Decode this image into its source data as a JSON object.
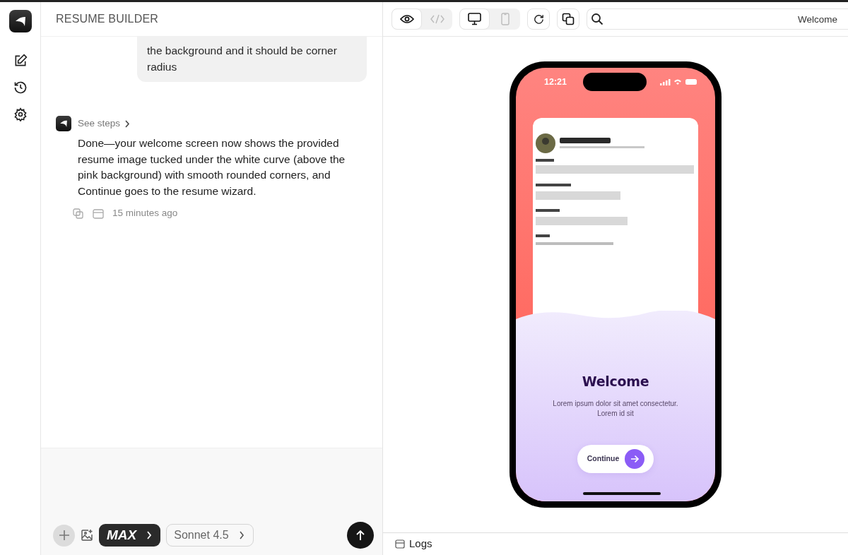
{
  "app": {
    "title": "RESUME BUILDER"
  },
  "chat": {
    "user_message": "the background and it should be corner radius",
    "steps_label": "See steps",
    "reply": "Done—your welcome screen now shows the provided resume image tucked under the white curve (above the pink background) with smooth rounded corners, and Continue goes to the resume wizard.",
    "time": "15 minutes ago"
  },
  "composer": {
    "mode": "MAX",
    "model": "Sonnet 4.5"
  },
  "preview": {
    "view_modes": [
      {
        "kind": "preview",
        "selected": true
      },
      {
        "kind": "code",
        "selected": false
      }
    ],
    "devices": [
      {
        "kind": "desktop",
        "selected": true
      },
      {
        "kind": "mobile",
        "selected": false
      }
    ],
    "address": "Welcome"
  },
  "phone": {
    "time": "12:21",
    "title": "Welcome",
    "subtitle": "Lorem ipsum dolor sit amet consectetur. Lorem id sit",
    "button": "Continue"
  },
  "logs": {
    "label": "Logs"
  }
}
